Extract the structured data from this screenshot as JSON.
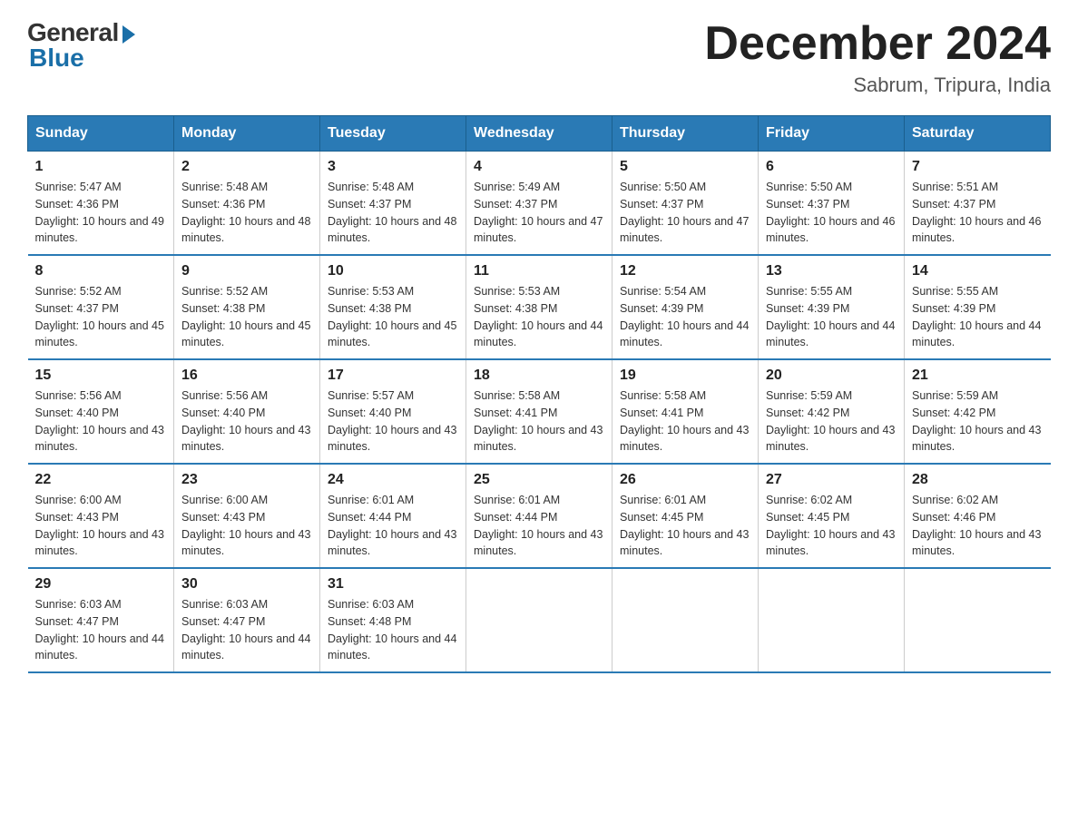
{
  "logo": {
    "general": "General",
    "blue": "Blue"
  },
  "title": "December 2024",
  "subtitle": "Sabrum, Tripura, India",
  "weekdays": [
    "Sunday",
    "Monday",
    "Tuesday",
    "Wednesday",
    "Thursday",
    "Friday",
    "Saturday"
  ],
  "weeks": [
    [
      {
        "day": "1",
        "sunrise": "5:47 AM",
        "sunset": "4:36 PM",
        "daylight": "10 hours and 49 minutes."
      },
      {
        "day": "2",
        "sunrise": "5:48 AM",
        "sunset": "4:36 PM",
        "daylight": "10 hours and 48 minutes."
      },
      {
        "day": "3",
        "sunrise": "5:48 AM",
        "sunset": "4:37 PM",
        "daylight": "10 hours and 48 minutes."
      },
      {
        "day": "4",
        "sunrise": "5:49 AM",
        "sunset": "4:37 PM",
        "daylight": "10 hours and 47 minutes."
      },
      {
        "day": "5",
        "sunrise": "5:50 AM",
        "sunset": "4:37 PM",
        "daylight": "10 hours and 47 minutes."
      },
      {
        "day": "6",
        "sunrise": "5:50 AM",
        "sunset": "4:37 PM",
        "daylight": "10 hours and 46 minutes."
      },
      {
        "day": "7",
        "sunrise": "5:51 AM",
        "sunset": "4:37 PM",
        "daylight": "10 hours and 46 minutes."
      }
    ],
    [
      {
        "day": "8",
        "sunrise": "5:52 AM",
        "sunset": "4:37 PM",
        "daylight": "10 hours and 45 minutes."
      },
      {
        "day": "9",
        "sunrise": "5:52 AM",
        "sunset": "4:38 PM",
        "daylight": "10 hours and 45 minutes."
      },
      {
        "day": "10",
        "sunrise": "5:53 AM",
        "sunset": "4:38 PM",
        "daylight": "10 hours and 45 minutes."
      },
      {
        "day": "11",
        "sunrise": "5:53 AM",
        "sunset": "4:38 PM",
        "daylight": "10 hours and 44 minutes."
      },
      {
        "day": "12",
        "sunrise": "5:54 AM",
        "sunset": "4:39 PM",
        "daylight": "10 hours and 44 minutes."
      },
      {
        "day": "13",
        "sunrise": "5:55 AM",
        "sunset": "4:39 PM",
        "daylight": "10 hours and 44 minutes."
      },
      {
        "day": "14",
        "sunrise": "5:55 AM",
        "sunset": "4:39 PM",
        "daylight": "10 hours and 44 minutes."
      }
    ],
    [
      {
        "day": "15",
        "sunrise": "5:56 AM",
        "sunset": "4:40 PM",
        "daylight": "10 hours and 43 minutes."
      },
      {
        "day": "16",
        "sunrise": "5:56 AM",
        "sunset": "4:40 PM",
        "daylight": "10 hours and 43 minutes."
      },
      {
        "day": "17",
        "sunrise": "5:57 AM",
        "sunset": "4:40 PM",
        "daylight": "10 hours and 43 minutes."
      },
      {
        "day": "18",
        "sunrise": "5:58 AM",
        "sunset": "4:41 PM",
        "daylight": "10 hours and 43 minutes."
      },
      {
        "day": "19",
        "sunrise": "5:58 AM",
        "sunset": "4:41 PM",
        "daylight": "10 hours and 43 minutes."
      },
      {
        "day": "20",
        "sunrise": "5:59 AM",
        "sunset": "4:42 PM",
        "daylight": "10 hours and 43 minutes."
      },
      {
        "day": "21",
        "sunrise": "5:59 AM",
        "sunset": "4:42 PM",
        "daylight": "10 hours and 43 minutes."
      }
    ],
    [
      {
        "day": "22",
        "sunrise": "6:00 AM",
        "sunset": "4:43 PM",
        "daylight": "10 hours and 43 minutes."
      },
      {
        "day": "23",
        "sunrise": "6:00 AM",
        "sunset": "4:43 PM",
        "daylight": "10 hours and 43 minutes."
      },
      {
        "day": "24",
        "sunrise": "6:01 AM",
        "sunset": "4:44 PM",
        "daylight": "10 hours and 43 minutes."
      },
      {
        "day": "25",
        "sunrise": "6:01 AM",
        "sunset": "4:44 PM",
        "daylight": "10 hours and 43 minutes."
      },
      {
        "day": "26",
        "sunrise": "6:01 AM",
        "sunset": "4:45 PM",
        "daylight": "10 hours and 43 minutes."
      },
      {
        "day": "27",
        "sunrise": "6:02 AM",
        "sunset": "4:45 PM",
        "daylight": "10 hours and 43 minutes."
      },
      {
        "day": "28",
        "sunrise": "6:02 AM",
        "sunset": "4:46 PM",
        "daylight": "10 hours and 43 minutes."
      }
    ],
    [
      {
        "day": "29",
        "sunrise": "6:03 AM",
        "sunset": "4:47 PM",
        "daylight": "10 hours and 44 minutes."
      },
      {
        "day": "30",
        "sunrise": "6:03 AM",
        "sunset": "4:47 PM",
        "daylight": "10 hours and 44 minutes."
      },
      {
        "day": "31",
        "sunrise": "6:03 AM",
        "sunset": "4:48 PM",
        "daylight": "10 hours and 44 minutes."
      },
      null,
      null,
      null,
      null
    ]
  ]
}
